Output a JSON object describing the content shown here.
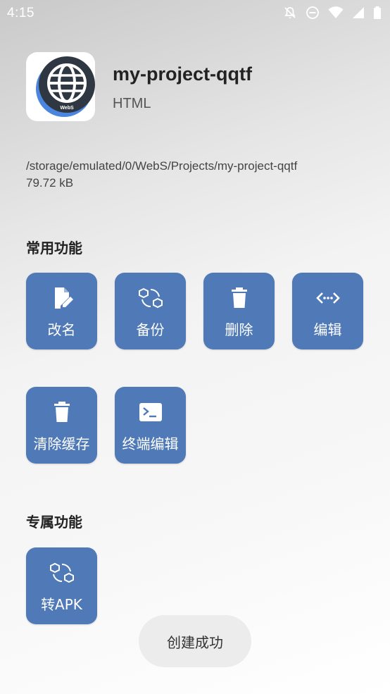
{
  "status": {
    "time": "4:15"
  },
  "project": {
    "name": "my-project-qqtf",
    "type": "HTML",
    "path": "/storage/emulated/0/WebS/Projects/my-project-qqtf",
    "size": "79.72 kB",
    "icon_text": "WebS"
  },
  "sections": {
    "common_title": "常用功能",
    "exclusive_title": "专属功能"
  },
  "tiles": {
    "rename": "改名",
    "backup": "备份",
    "delete": "删除",
    "edit": "编辑",
    "clear_cache": "清除缓存",
    "terminal_edit": "终端编辑",
    "to_apk": "转APK"
  },
  "toast": "创建成功"
}
